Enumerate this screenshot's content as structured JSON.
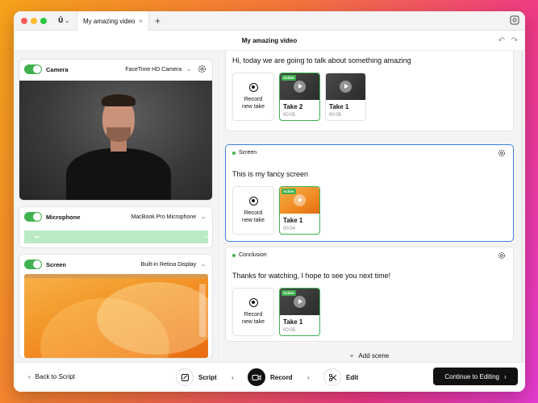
{
  "window": {
    "tab_title": "My amazing video",
    "tab_close": "×",
    "new_tab": "+",
    "app_logo": "ύ",
    "app_logo_chevron": "⌄"
  },
  "doc": {
    "title": "My amazing video",
    "undo": "↶",
    "redo": "↷"
  },
  "sources": {
    "camera": {
      "label": "Camera",
      "device": "FaceTime HD Camera",
      "enabled": true
    },
    "microphone": {
      "label": "Microphone",
      "device": "MacBook Pro Microphone",
      "enabled": true
    },
    "screen": {
      "label": "Screen",
      "device": "Built-in Retina Display",
      "enabled": true
    }
  },
  "scenes": [
    {
      "name": "",
      "script": "Hi, today we are going to talk about something amazing",
      "record_new": [
        "Record",
        "new take"
      ],
      "takes": [
        {
          "name": "Take 2",
          "duration": "00:05",
          "badge": "Active",
          "selected": true
        },
        {
          "name": "Take 1",
          "duration": "00:05",
          "badge": "",
          "selected": false
        }
      ]
    },
    {
      "name": "Screen",
      "script": "This is my fancy screen",
      "record_new": [
        "Record",
        "new take"
      ],
      "takes": [
        {
          "name": "Take 1",
          "duration": "00:04",
          "badge": "Active",
          "selected": true
        }
      ]
    },
    {
      "name": "Conclusion",
      "script": "Thanks for watching, I hope to see you next time!",
      "record_new": [
        "Record",
        "new take"
      ],
      "takes": [
        {
          "name": "Take 1",
          "duration": "00:05",
          "badge": "Active",
          "selected": true
        }
      ]
    }
  ],
  "add_scene": "Add scene",
  "add_scene_icon": "+",
  "footer": {
    "back": "Back to Script",
    "back_arrow": "‹",
    "steps": [
      {
        "label": "Script"
      },
      {
        "label": "Record"
      },
      {
        "label": "Edit"
      }
    ],
    "step_arrow": "›",
    "continue": "Continue to Editing",
    "continue_arrow": "›"
  },
  "colors": {
    "accent_green": "#3fb24f",
    "active_border": "#3e7ee0",
    "primary_button": "#111111"
  }
}
